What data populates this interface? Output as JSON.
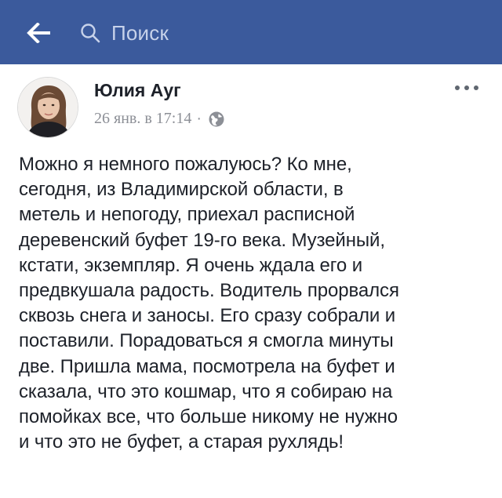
{
  "header": {
    "search_placeholder": "Поиск"
  },
  "post": {
    "author": "Юлия Ауг",
    "date": "26 янв. в 17:14",
    "separator": "·",
    "lines": [
      "Можно я немного пожалуюсь? Ко мне,",
      "сегодня, из Владимирской области, в",
      "метель и непогоду, приехал расписной",
      "деревенский буфет 19-го века. Музейный,",
      "кстати, экземпляр. Я очень ждала его и",
      "предвкушала радость. Водитель прорвался",
      "сквозь снега и заносы. Его сразу собрали и",
      "поставили. Порадоваться я смогла минуты",
      "две. Пришла мама, посмотрела на буфет и",
      "сказала, что это кошмар, что я собираю на",
      "помойках все, что больше никому не нужно",
      "и что это не буфет, а старая рухлядь!"
    ]
  },
  "colors": {
    "brand": "#3b5a9c",
    "text": "#1d2129",
    "meta": "#8c8f96"
  },
  "icons": {
    "back": "back-arrow-icon",
    "search": "search-icon",
    "more": "more-options-icon",
    "privacy": "globe-icon"
  }
}
